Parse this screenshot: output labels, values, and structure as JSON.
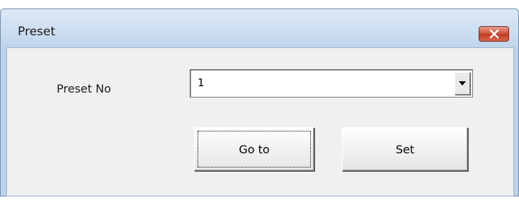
{
  "window": {
    "title": "Preset",
    "close_icon": "close-icon"
  },
  "form": {
    "preset_no_label": "Preset No",
    "preset_no_value": "1",
    "dropdown_icon": "chevron-down-icon"
  },
  "buttons": {
    "goto_label": "Go to",
    "set_label": "Set"
  },
  "colors": {
    "titlebar": "#c8dbef",
    "client": "#f0f0f0",
    "close_button": "#c23a22"
  }
}
